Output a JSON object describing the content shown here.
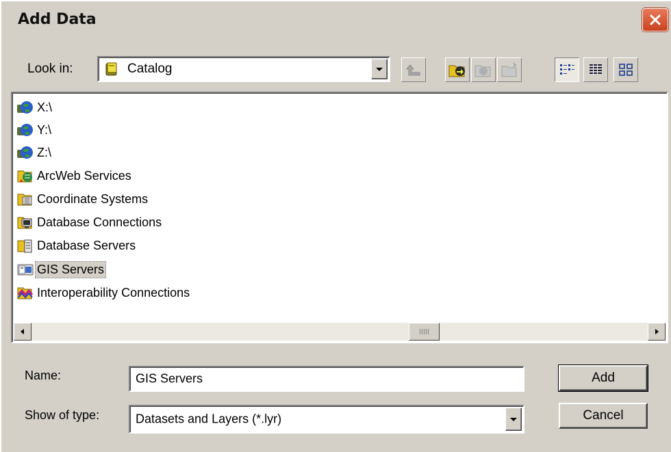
{
  "window": {
    "title": "Add Data"
  },
  "look_in": {
    "label": "Look in:",
    "value": "Catalog"
  },
  "toolbar": {
    "buttons": [
      "up-one-level-icon",
      "connect-to-folder-icon",
      "disconnect-folder-icon",
      "new-item-icon",
      "list-view-icon",
      "details-view-icon",
      "thumbnails-view-icon"
    ]
  },
  "items": [
    {
      "label": "X:\\",
      "icon": "network-drive-icon"
    },
    {
      "label": "Y:\\",
      "icon": "network-drive-icon"
    },
    {
      "label": "Z:\\",
      "icon": "network-drive-icon"
    },
    {
      "label": "ArcWeb Services",
      "icon": "arcweb-services-icon"
    },
    {
      "label": "Coordinate Systems",
      "icon": "coordinate-systems-icon"
    },
    {
      "label": "Database Connections",
      "icon": "database-connections-icon"
    },
    {
      "label": "Database Servers",
      "icon": "database-servers-icon"
    },
    {
      "label": "GIS Servers",
      "icon": "gis-servers-icon"
    },
    {
      "label": "Interoperability Connections",
      "icon": "interoperability-icon"
    }
  ],
  "selected_item": "GIS Servers",
  "name_field": {
    "label": "Name:",
    "value": "GIS Servers"
  },
  "type_field": {
    "label": "Show of type:",
    "value": "Datasets and Layers (*.lyr)"
  },
  "buttons": {
    "add": "Add",
    "cancel": "Cancel"
  }
}
